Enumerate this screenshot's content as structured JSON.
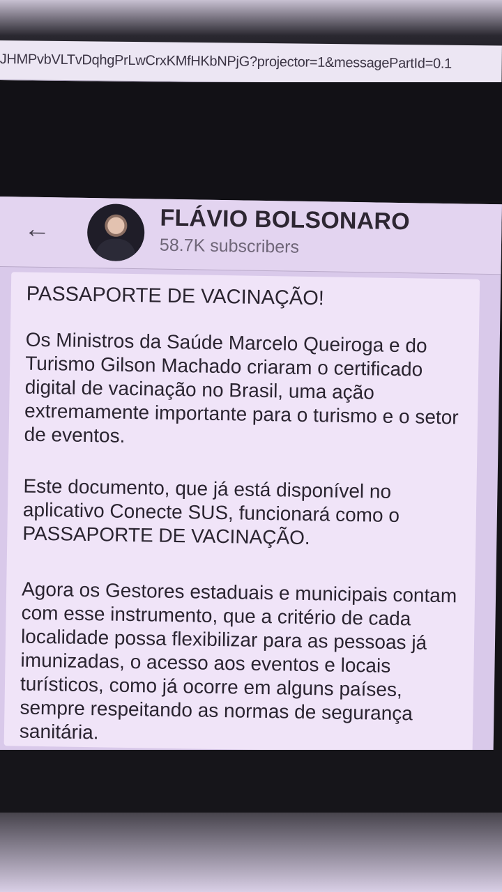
{
  "browser": {
    "url": "JHMPvbVLTvDqhgPrLwCrxKMfHKbNPjG?projector=1&messagePartId=0.1"
  },
  "channel": {
    "back_label": "←",
    "name": "FLÁVIO BOLSONARO",
    "subscribers": "58.7K subscribers"
  },
  "message": {
    "title": "PASSAPORTE DE VACINAÇÃO!",
    "paragraph_1": "Os Ministros da Saúde Marcelo Queiroga e do Turismo Gilson Machado criaram o certificado digital de vacinação no Brasil, uma ação extremamente importante para o turismo e o setor de eventos.",
    "paragraph_2": "Este documento, que já está disponível no aplicativo Conecte SUS, funcionará como o PASSAPORTE DE VACINAÇÃO.",
    "paragraph_3": "Agora os Gestores estaduais e municipais contam com esse instrumento, que a critério de cada localidade possa flexibilizar para as pessoas já imunizadas, o acesso aos eventos e locais turísticos, como já ocorre em alguns países, sempre respeitando as normas de segurança sanitária."
  }
}
